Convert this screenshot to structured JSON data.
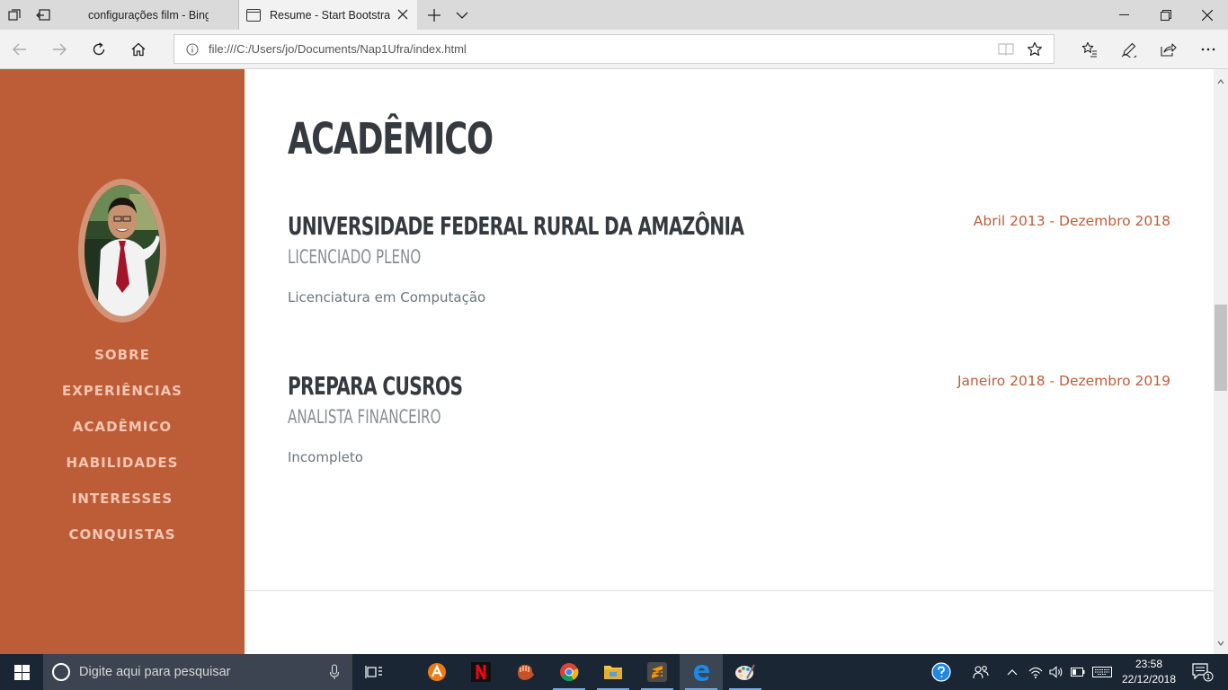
{
  "browser": {
    "tabs": [
      {
        "title": "configurações film - Bing",
        "active": false
      },
      {
        "title": "Resume - Start Bootstra",
        "active": true
      }
    ],
    "address": "file:///C:/Users/jo/Documents/Nap1Ufra/index.html"
  },
  "sidebar": {
    "nav": [
      "SOBRE",
      "EXPERIÊNCIAS",
      "ACADÊMICO",
      "HABILIDADES",
      "INTERESSES",
      "CONQUISTAS"
    ]
  },
  "section": {
    "title": "ACADÊMICO",
    "entries": [
      {
        "school": "UNIVERSIDADE FEDERAL RURAL DA AMAZÔNIA",
        "degree": "LICENCIADO PLENO",
        "description": "Licenciatura em Computação",
        "date": "Abril 2013 - Dezembro 2018"
      },
      {
        "school": "PREPARA CUSROS",
        "degree": "ANALISTA FINANCEIRO",
        "description": "Incompleto",
        "date": "Janeiro 2018 - Dezembro 2019"
      }
    ]
  },
  "taskbar": {
    "search_placeholder": "Digite aqui para pesquisar",
    "time": "23:58",
    "date": "22/12/2018",
    "notification_count": "1"
  },
  "colors": {
    "sidebar": "#bd5d38",
    "accent": "#bd5d38",
    "heading": "#343a40"
  }
}
